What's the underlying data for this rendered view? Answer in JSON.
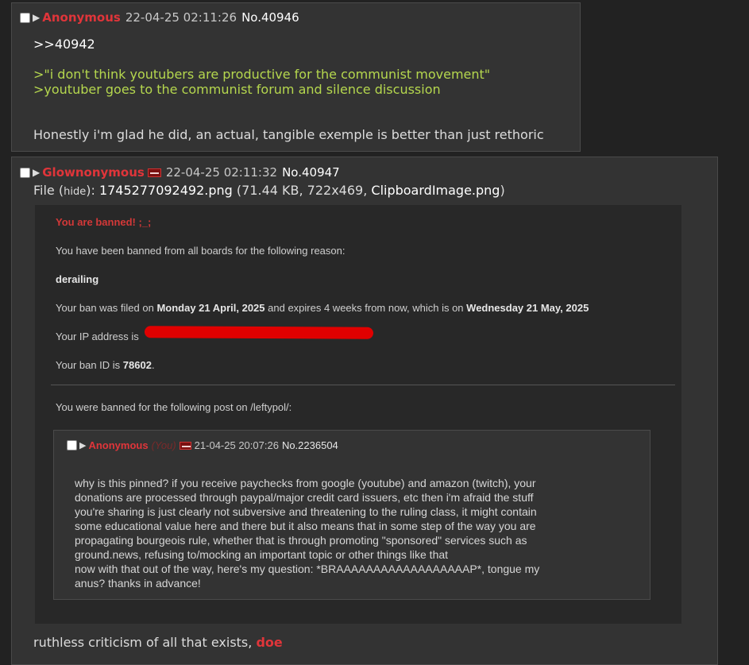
{
  "post1": {
    "name": "Anonymous",
    "date": "22-04-25 02:11:26",
    "number": "No.40946",
    "reply_link": ">>40942",
    "greentext": [
      ">\"i don't think youtubers are productive for the communist movement\"",
      ">youtuber goes to the communist forum and silence discussion"
    ],
    "text": "Honestly i'm glad he did, an actual, tangible exemple is better than just rethoric"
  },
  "post2": {
    "name": "Glownonymous",
    "date": "22-04-25 02:11:32",
    "number": "No.40947",
    "file_prefix": "File (",
    "file_hide": "hide",
    "file_mid": "): ",
    "file_name": "1745277092492.png",
    "file_info": " (71.44 KB, 722x469, ",
    "file_original": "ClipboardImage.png",
    "file_end": ")",
    "footer_text": "ruthless criticism of all that exists, ",
    "footer_highlight": "doe"
  },
  "screenshot": {
    "title": "You are banned! ;_;",
    "line_reason_intro": "You have been banned from all boards for the following reason:",
    "reason": "derailing",
    "filed_prefix": "Your ban was filed on ",
    "filed_date": "Monday 21 April, 2025",
    "filed_mid": " and expires 4 weeks from now, which is on ",
    "expire_date": "Wednesday 21 May, 2025",
    "ip_label": "Your IP address is",
    "banid_prefix": "Your ban ID is ",
    "banid": "78602",
    "banid_suffix": ".",
    "post_intro": "You were banned for the following post on /leftypol/:",
    "inner_post": {
      "name": "Anonymous",
      "you": "(You)",
      "date": "21-04-25 20:07:26",
      "number": "No.2236504",
      "lines": [
        "why is this pinned? if you receive paychecks from google (youtube) and amazon (twitch), your",
        "donations are processed through paypal/major credit card issuers, etc then i'm afraid the stuff",
        "you're sharing is just clearly not subversive and threatening to the ruling class, it might contain",
        "some educational value here and there but it also means that in some step of the way you are",
        "propagating bourgeois rule, whether that is through promoting \"sponsored\" services such as",
        "ground.news, refusing to/mocking an important topic or other things like that",
        "now with that out of the way, here's my question: *BRAAAAAAAAAAAAAAAAAAP*, tongue my",
        "anus? thanks in advance!"
      ]
    }
  },
  "colors": {
    "name_red": "#e0353a",
    "greentext": "#b5d74e",
    "post_bg": "#333333",
    "page_bg": "#222222"
  }
}
